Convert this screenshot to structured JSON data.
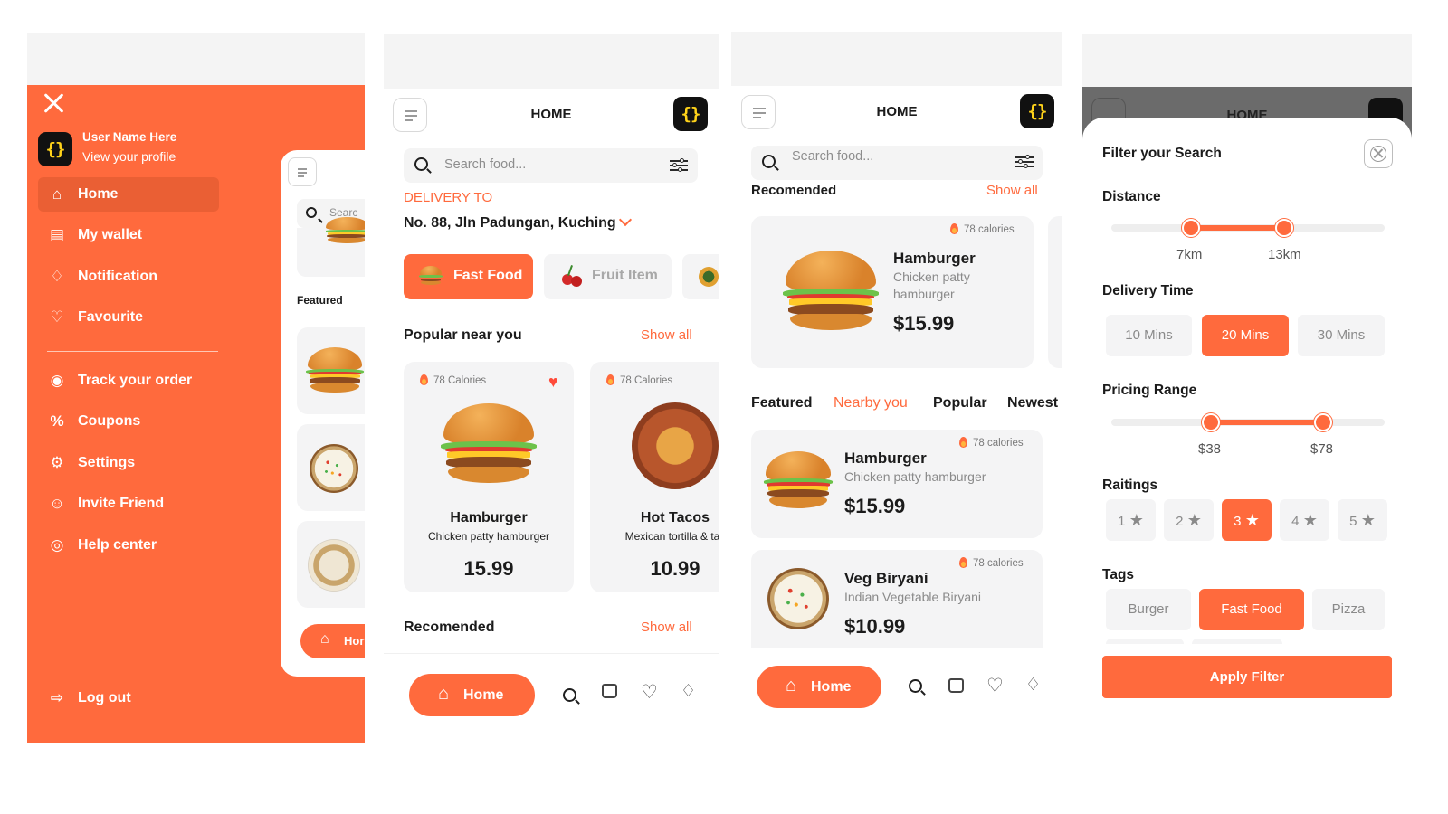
{
  "sidebar": {
    "user_name": "User Name Here",
    "profile_link": "View your profile",
    "logo_text": "{}",
    "items": [
      {
        "label": "Home",
        "icon": "home-icon"
      },
      {
        "label": "My wallet",
        "icon": "wallet-icon"
      },
      {
        "label": "Notification",
        "icon": "bell-icon"
      },
      {
        "label": "Favourite",
        "icon": "heart-icon"
      },
      {
        "label": "Track your order",
        "icon": "location-icon"
      },
      {
        "label": "Coupons",
        "icon": "coupon-icon"
      },
      {
        "label": "Settings",
        "icon": "gear-icon"
      },
      {
        "label": "Invite Friend",
        "icon": "user-add-icon"
      },
      {
        "label": "Help center",
        "icon": "help-icon"
      }
    ],
    "logout_label": "Log out",
    "peek": {
      "search_placeholder": "Searc",
      "featured": "Featured",
      "home": "Hor"
    }
  },
  "home": {
    "title": "HOME",
    "logo_text": "{}",
    "search_placeholder": "Search food...",
    "delivery_label": "DELIVERY TO",
    "address": "No. 88, Jln Padungan, Kuching",
    "categories": [
      {
        "label": "Fast Food",
        "active": true
      },
      {
        "label": "Fruit Item",
        "active": false
      }
    ],
    "popular_title": "Popular near you",
    "show_all": "Show all",
    "popular": [
      {
        "calories": "78 Calories",
        "name": "Hamburger",
        "desc": "Chicken patty hamburger",
        "price": "15.99"
      },
      {
        "calories": "78 Calories",
        "name": "Hot Tacos",
        "desc": "Mexican tortilla & tac",
        "price": "10.99"
      }
    ],
    "recommended_title": "Recomended",
    "nav_home": "Home"
  },
  "home2": {
    "title": "HOME",
    "logo_text": "{}",
    "search_placeholder": "Search food...",
    "recommended_title": "Recomended",
    "show_all": "Show all",
    "featured_card": {
      "calories": "78 calories",
      "name": "Hamburger",
      "desc_line1": "Chicken patty",
      "desc_line2": "hamburger",
      "price": "$15.99"
    },
    "tabs": [
      "Featured",
      "Nearby you",
      "Popular",
      "Newest"
    ],
    "list": [
      {
        "calories": "78 calories",
        "name": "Hamburger",
        "desc": "Chicken patty hamburger",
        "price": "$15.99"
      },
      {
        "calories": "78 calories",
        "name": "Veg Biryani",
        "desc": "Indian Vegetable Biryani",
        "price": "$10.99"
      }
    ],
    "nav_home": "Home"
  },
  "filter": {
    "bg_title": "HOME",
    "title": "Filter your Search",
    "distance_label": "Distance",
    "distance_min": "7km",
    "distance_max": "13km",
    "distance_range_km": [
      7,
      13
    ],
    "delivery_label": "Delivery Time",
    "delivery_options": [
      "10 Mins",
      "20 Mins",
      "30 Mins"
    ],
    "delivery_selected": "20 Mins",
    "pricing_label": "Pricing Range",
    "price_min": "$38",
    "price_max": "$78",
    "ratings_label": "Raitings",
    "ratings": [
      "1",
      "2",
      "3",
      "4",
      "5"
    ],
    "rating_selected": "3",
    "tags_label": "Tags",
    "tags": [
      "Burger",
      "Fast Food",
      "Pizza"
    ],
    "tag_selected": "Fast Food",
    "apply_label": "Apply Filter"
  },
  "colors": {
    "accent": "#ff6a3d",
    "dark": "#111111",
    "logo_yellow": "#ffd31a"
  }
}
